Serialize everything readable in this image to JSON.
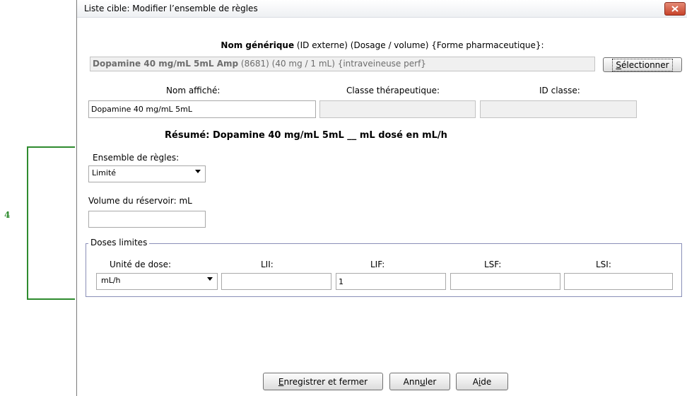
{
  "annotation": {
    "callout_number": "4"
  },
  "dialog": {
    "title": "Liste cible: Modifier l’ensemble de règles",
    "generic_header": {
      "bold": "Nom générique",
      "rest": " (ID externe) (Dosage / volume) {Forme pharmaceutique}:"
    },
    "generic_field": {
      "name_bold": "Dopamine 40 mg/mL 5mL Amp",
      "details": " (8681) (40 mg / 1 mL) {intraveineuse perf}"
    },
    "select_button": {
      "accel": "S",
      "rest": "électionner"
    },
    "display_name": {
      "label": "Nom affiché:",
      "value": "Dopamine 40 mg/mL  5mL"
    },
    "therapeutic_class": {
      "label": "Classe thérapeutique:",
      "value": ""
    },
    "class_id": {
      "label": "ID classe:",
      "value": ""
    },
    "summary": "Résumé: Dopamine 40 mg/mL  5mL __ mL dosé en mL/h",
    "rule_set": {
      "label": "Ensemble de règles:",
      "selected": "Limité"
    },
    "reservoir_volume": {
      "label": "Volume du réservoir: mL",
      "value": ""
    },
    "dose_limits": {
      "legend": "Doses limites",
      "dose_unit": {
        "label": "Unité de dose:",
        "selected": "mL/h"
      },
      "lii": {
        "label": "LII:",
        "value": ""
      },
      "lif": {
        "label": "LIF:",
        "value": "1"
      },
      "lsf": {
        "label": "LSF:",
        "value": ""
      },
      "lsi": {
        "label": "LSI:",
        "value": ""
      }
    },
    "buttons": {
      "save": {
        "accel": "E",
        "rest": "nregistrer et fermer"
      },
      "cancel": {
        "pre": "Ann",
        "accel": "u",
        "post": "ler"
      },
      "help": {
        "pre": "A",
        "accel": "i",
        "post": "de"
      }
    }
  }
}
